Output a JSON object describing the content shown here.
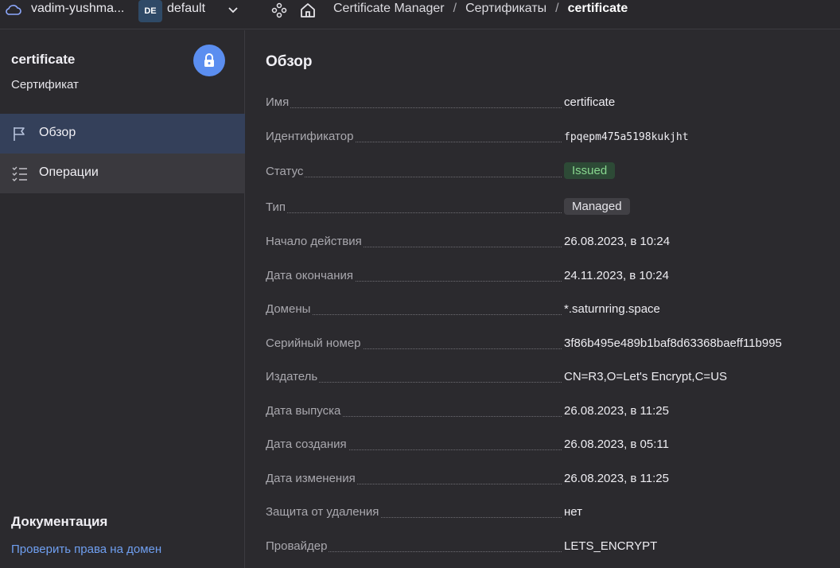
{
  "topbar": {
    "cloud_name": "vadim-yushma...",
    "folder_badge": "DE",
    "folder_name": "default",
    "breadcrumbs": [
      "Certificate Manager",
      "Сертификаты",
      "certificate"
    ]
  },
  "sidebar": {
    "title": "certificate",
    "subtitle": "Сертификат",
    "items": [
      {
        "label": "Обзор",
        "icon": "flag-icon",
        "active": true
      },
      {
        "label": "Операции",
        "icon": "checklist-icon",
        "active": false
      }
    ],
    "docs_title": "Документация",
    "docs_link": "Проверить права на домен"
  },
  "main": {
    "title": "Обзор",
    "fields": [
      {
        "key": "Имя",
        "value": "certificate"
      },
      {
        "key": "Идентификатор",
        "value": "fpqepm475a5198kukjht"
      },
      {
        "key": "Статус",
        "value": "Issued"
      },
      {
        "key": "Тип",
        "value": "Managed"
      },
      {
        "key": "Начало действия",
        "value": "26.08.2023, в 10:24"
      },
      {
        "key": "Дата окончания",
        "value": "24.11.2023, в 10:24"
      },
      {
        "key": "Домены",
        "value": "*.saturnring.space"
      },
      {
        "key": "Серийный номер",
        "value": "3f86b495e489b1baf8d63368baeff11b995"
      },
      {
        "key": "Издатель",
        "value": "CN=R3,O=Let's Encrypt,C=US"
      },
      {
        "key": "Дата выпуска",
        "value": "26.08.2023, в 11:25"
      },
      {
        "key": "Дата создания",
        "value": "26.08.2023, в 05:11"
      },
      {
        "key": "Дата изменения",
        "value": "26.08.2023, в 11:25"
      },
      {
        "key": "Защита от удаления",
        "value": "нет"
      },
      {
        "key": "Провайдер",
        "value": "LETS_ENCRYPT"
      }
    ]
  },
  "colors": {
    "accent": "#5b8ef0",
    "status_issued": "#88d78f",
    "link": "#6f9ff0"
  }
}
